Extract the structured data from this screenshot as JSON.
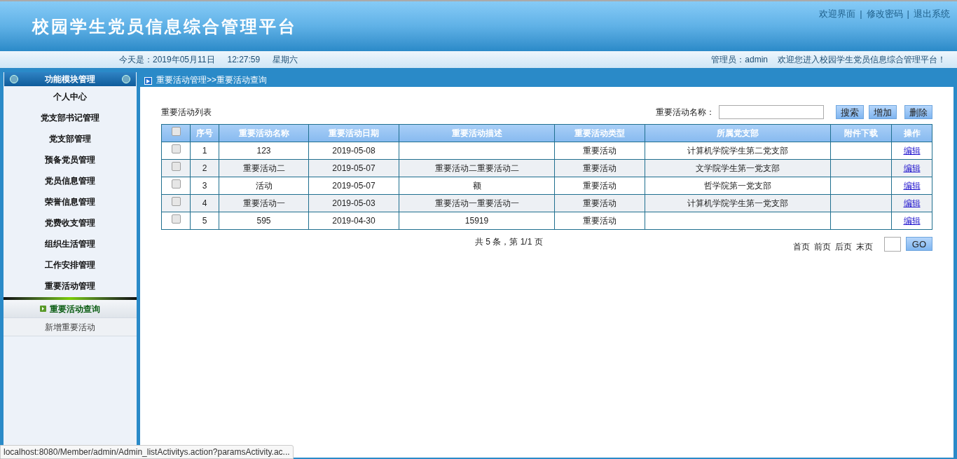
{
  "header": {
    "title": "校园学生党员信息综合管理平台",
    "links": [
      "欢迎界面",
      "修改密码",
      "退出系统"
    ],
    "separator": "|"
  },
  "info_bar": {
    "left": [
      "今天是：2019年05月11日",
      "12:27:59",
      "星期六"
    ],
    "right": [
      "管理员：admin",
      "欢迎您进入校园学生党员信息综合管理平台！"
    ]
  },
  "sidebar": {
    "title": "功能模块管理",
    "items": [
      "个人中心",
      "党支部书记管理",
      "党支部管理",
      "预备党员管理",
      "党员信息管理",
      "荣誉信息管理",
      "党费收支管理",
      "组织生活管理",
      "工作安排管理",
      "重要活动管理"
    ],
    "subitems": [
      {
        "label": "重要活动查询",
        "selected": true
      },
      {
        "label": "新增重要活动",
        "selected": false
      }
    ]
  },
  "breadcrumb": "重要活动管理>>重要活动查询",
  "list_title": "重要活动列表",
  "search": {
    "label": "重要活动名称："
  },
  "buttons": [
    "搜索",
    "增加",
    "删除"
  ],
  "table": {
    "select_all_checked": false,
    "columns": [
      "序号",
      "重要活动名称",
      "重要活动日期",
      "重要活动描述",
      "重要活动类型",
      "所属党支部",
      "附件下载",
      "操作"
    ],
    "rows": [
      {
        "checked": false,
        "cells": [
          "1",
          "123",
          "2019-05-08",
          "",
          "重要活动",
          "计算机学院学生第二党支部",
          ""
        ],
        "action": "编辑"
      },
      {
        "checked": false,
        "cells": [
          "2",
          "重要活动二",
          "2019-05-07",
          "重要活动二重要活动二",
          "重要活动",
          "文学院学生第一党支部",
          ""
        ],
        "action": "编辑"
      },
      {
        "checked": false,
        "cells": [
          "3",
          "活动",
          "2019-05-07",
          "额",
          "重要活动",
          "哲学院第一党支部",
          ""
        ],
        "action": "编辑"
      },
      {
        "checked": false,
        "cells": [
          "4",
          "重要活动一",
          "2019-05-03",
          "重要活动一重要活动一",
          "重要活动",
          "计算机学院学生第一党支部",
          ""
        ],
        "action": "编辑"
      },
      {
        "checked": false,
        "cells": [
          "5",
          "595",
          "2019-04-30",
          "15919",
          "重要活动",
          "",
          ""
        ],
        "action": "编辑"
      }
    ]
  },
  "pager": {
    "summary": "共 5 条，第 1/1 页",
    "links": [
      "首页",
      "前页",
      "后页",
      "末页"
    ],
    "go": "GO"
  },
  "status_url": "localhost:8080/Member/admin/Admin_listActivitys.action?paramsActivity.ac..."
}
